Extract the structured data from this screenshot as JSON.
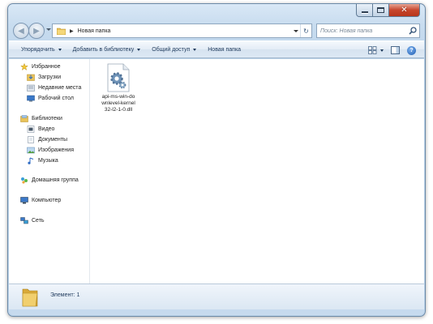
{
  "window": {
    "caption": {
      "minimize_icon": "minimize-icon",
      "maximize_icon": "maximize-icon",
      "close_icon": "close-icon",
      "close_glyph": "✕"
    }
  },
  "navigation": {
    "back_glyph": "◀",
    "forward_glyph": "▶",
    "address": {
      "separator": "▶",
      "path": "Новая папка",
      "refresh_glyph": "↻"
    },
    "search": {
      "placeholder": "Поиск: Новая папка"
    }
  },
  "toolbar": {
    "organize_label": "Упорядочить",
    "add_to_library_label": "Добавить в библиотеку",
    "share_label": "Общий доступ",
    "new_folder_label": "Новая папка",
    "help_glyph": "?"
  },
  "sidebar": {
    "favorites": {
      "label": "Избранное",
      "items": [
        {
          "label": "Загрузки",
          "icon": "downloads-icon"
        },
        {
          "label": "Недавние места",
          "icon": "recent-places-icon"
        },
        {
          "label": "Рабочий стол",
          "icon": "desktop-icon"
        }
      ]
    },
    "libraries": {
      "label": "Библиотеки",
      "items": [
        {
          "label": "Видео",
          "icon": "video-icon"
        },
        {
          "label": "Документы",
          "icon": "documents-icon"
        },
        {
          "label": "Изображения",
          "icon": "pictures-icon"
        },
        {
          "label": "Музыка",
          "icon": "music-icon"
        }
      ]
    },
    "homegroup": {
      "label": "Домашняя группа"
    },
    "computer": {
      "label": "Компьютер"
    },
    "network": {
      "label": "Сеть"
    }
  },
  "files": [
    {
      "name": "api-ms-win-downlevel-kernel32-l2-1-0.dll",
      "icon": "dll-file-icon"
    }
  ],
  "details": {
    "status": "Элемент: 1"
  },
  "colors": {
    "frame": "#bfd6ec",
    "command_text": "#1e395b",
    "close_button": "#c7462c",
    "folder": "#e8c25a"
  }
}
